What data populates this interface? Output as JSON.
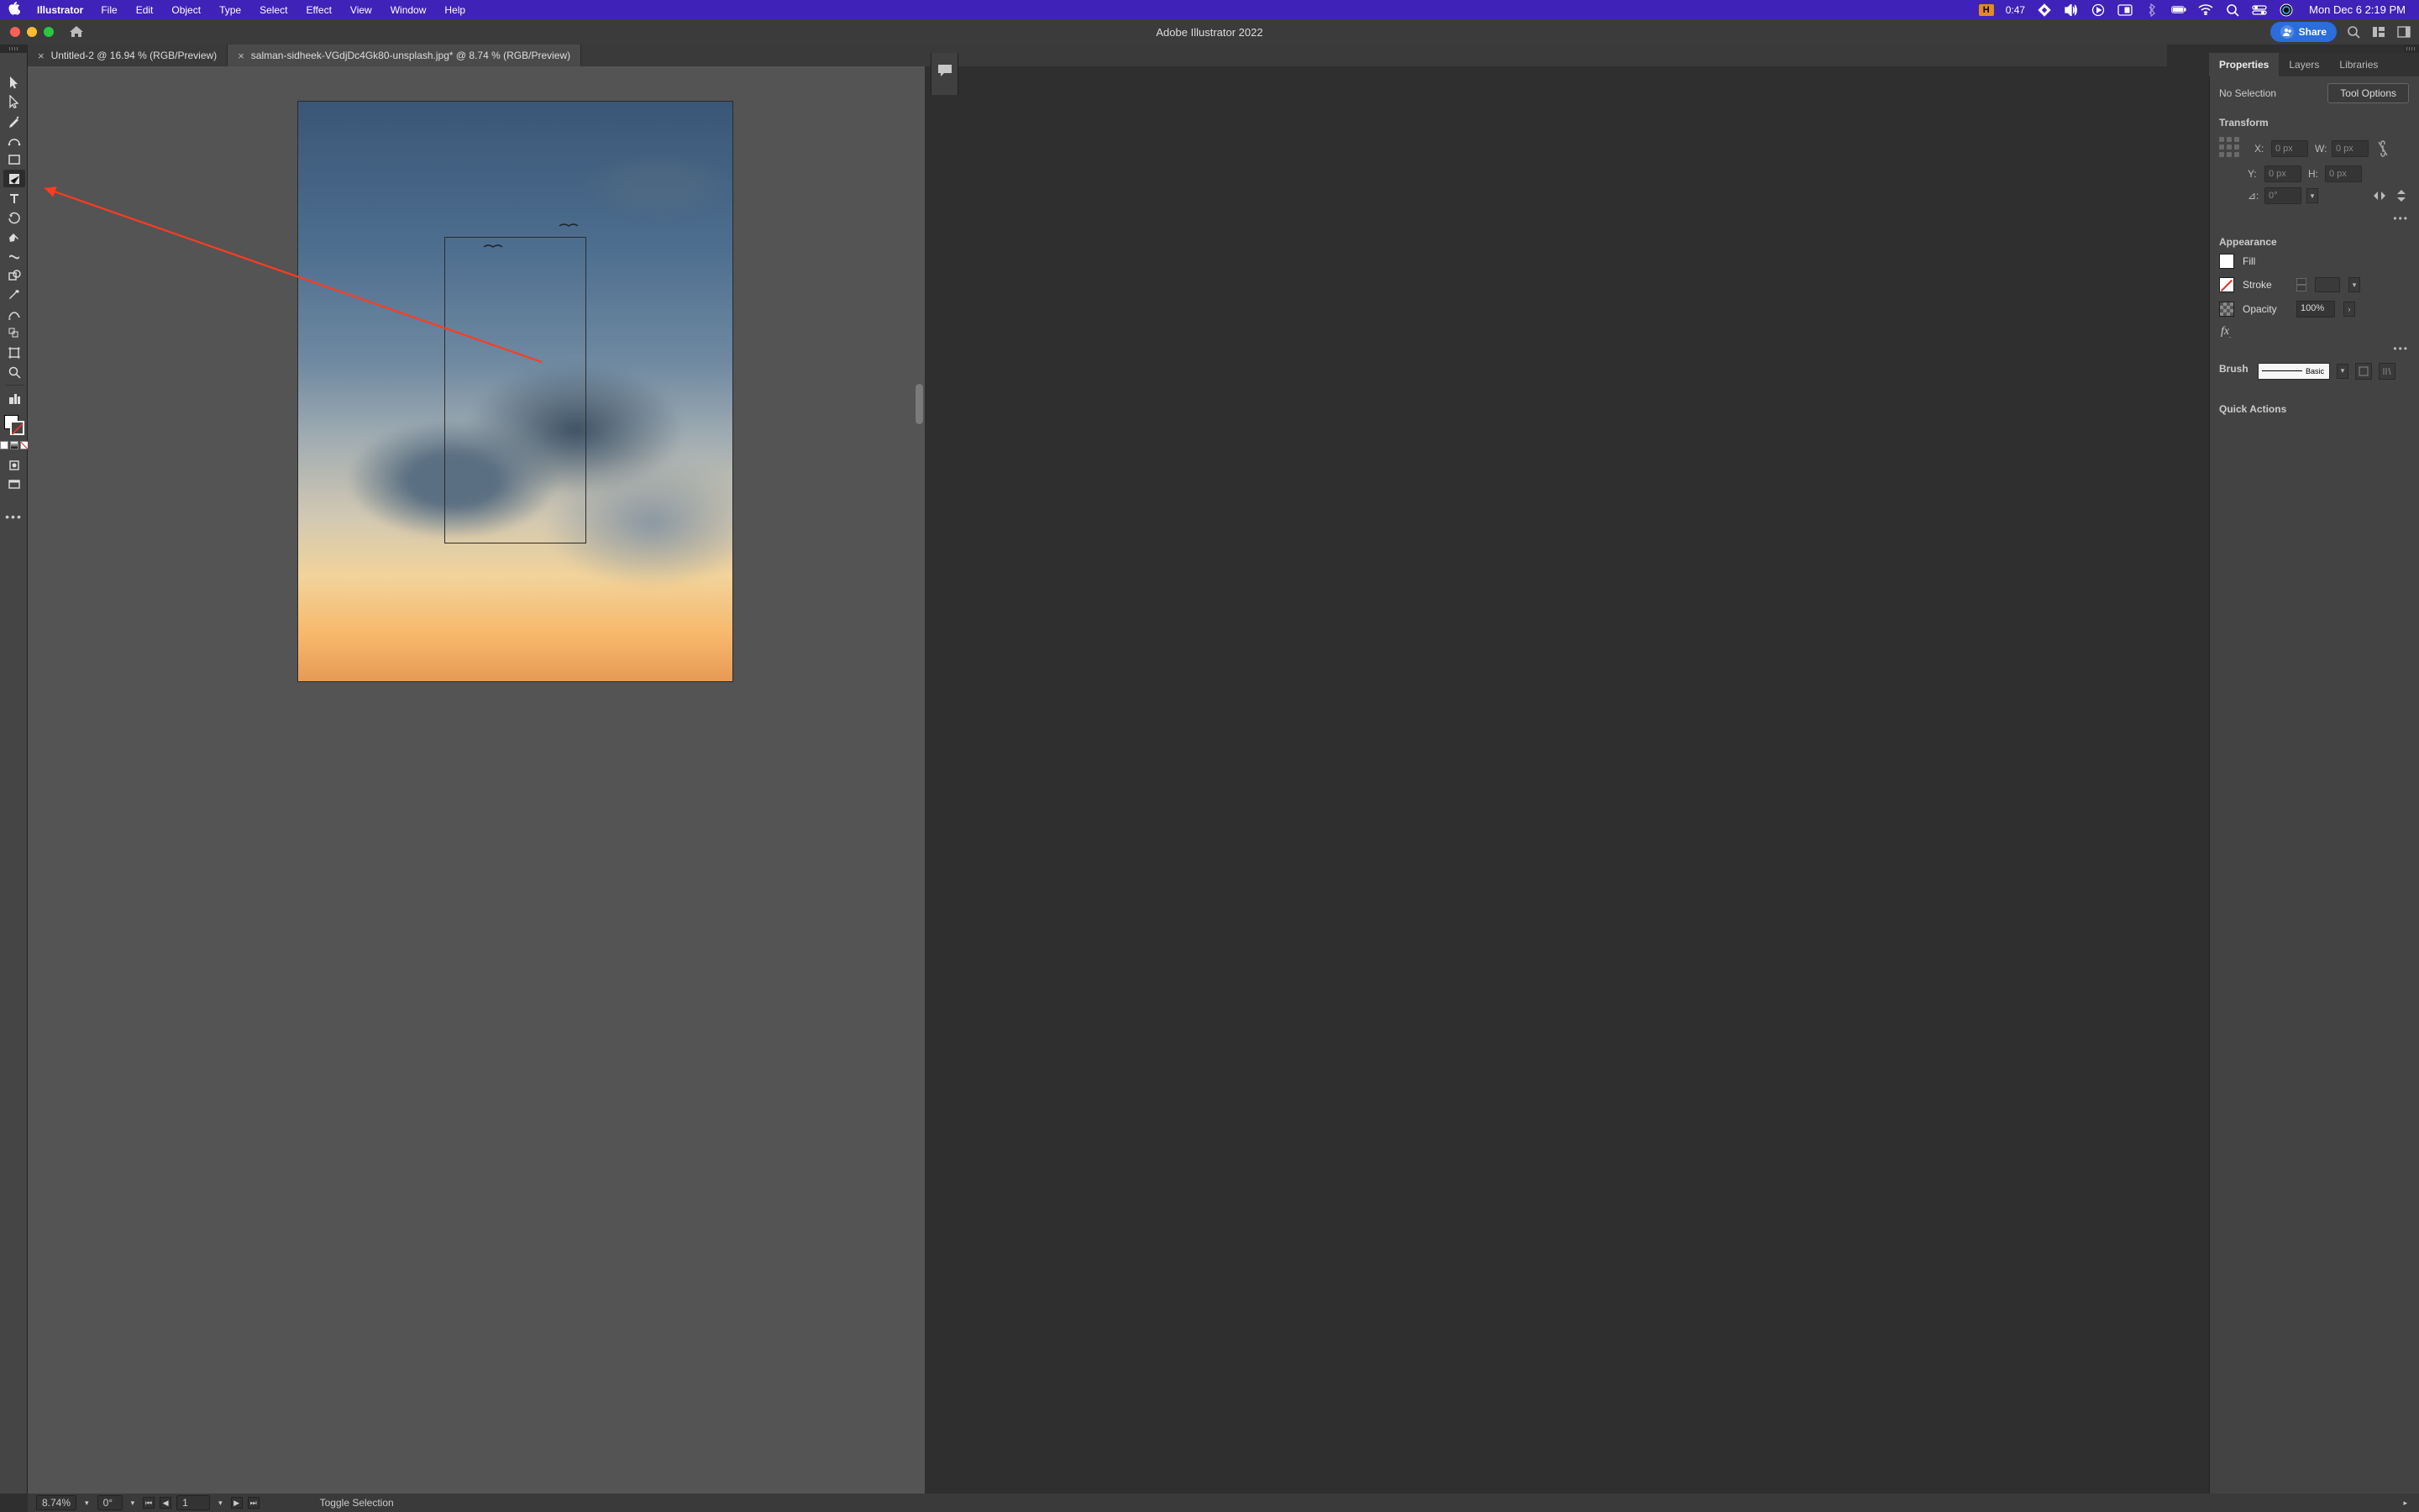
{
  "menubar": {
    "app_name": "Illustrator",
    "menus": [
      "File",
      "Edit",
      "Object",
      "Type",
      "Select",
      "Effect",
      "View",
      "Window",
      "Help"
    ],
    "brand_letter": "H",
    "timer": "0:47",
    "clock": "Mon Dec 6  2:19 PM"
  },
  "titlebar": {
    "title": "Adobe Illustrator 2022",
    "share": "Share"
  },
  "tabs": [
    {
      "label": "Untitled-2 @ 16.94 % (RGB/Preview)",
      "active": false
    },
    {
      "label": "salman-sidheek-VGdjDc4Gk80-unsplash.jpg* @ 8.74 % (RGB/Preview)",
      "active": true
    }
  ],
  "tools": [
    "selection",
    "direct-selection",
    "pen",
    "curve",
    "rectangle",
    "crop",
    "type",
    "rotate",
    "scale",
    "width",
    "shapebuilder",
    "eyedropper",
    "blend",
    "symbol",
    "artboard",
    "zoom"
  ],
  "tool_selected_index": 5,
  "panel": {
    "tabs": [
      "Properties",
      "Layers",
      "Libraries"
    ],
    "active_tab": 0,
    "selection_state": "No Selection",
    "tool_options_btn": "Tool Options",
    "transform": {
      "title": "Transform",
      "x_label": "X:",
      "y_label": "Y:",
      "w_label": "W:",
      "h_label": "H:",
      "x": "0 px",
      "y": "0 px",
      "w": "0 px",
      "h": "0 px",
      "angle_label": "⊿:",
      "angle": "0°"
    },
    "appearance": {
      "title": "Appearance",
      "fill_label": "Fill",
      "stroke_label": "Stroke",
      "opacity_label": "Opacity",
      "opacity_value": "100%"
    },
    "brush": {
      "title": "Brush",
      "preview_label": "Basic"
    },
    "quick_actions": "Quick Actions"
  },
  "statusbar": {
    "zoom": "8.74%",
    "rotate": "0°",
    "artboard": "1",
    "hint": "Toggle Selection"
  }
}
